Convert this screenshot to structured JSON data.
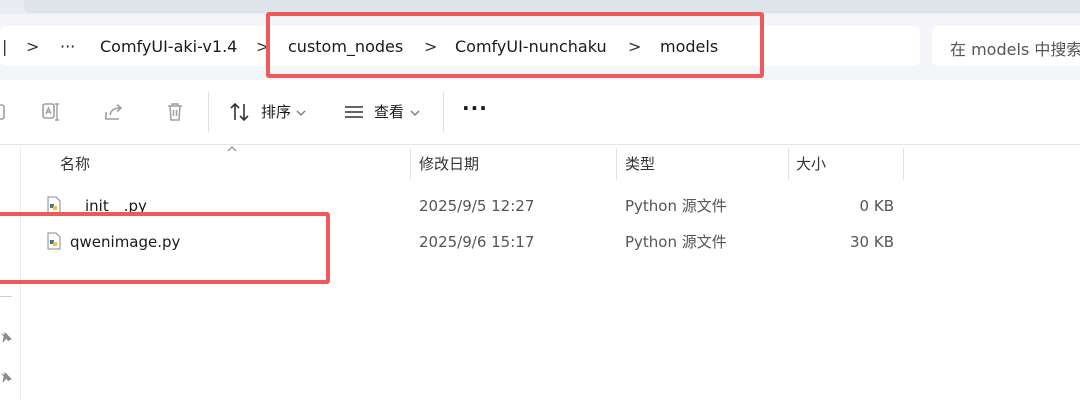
{
  "breadcrumbs": {
    "ellipsis": "···",
    "items": [
      "ComfyUI-aki-v1.4",
      "custom_nodes",
      "ComfyUI-nunchaku",
      "models"
    ],
    "separator": ">"
  },
  "search": {
    "placeholder": "在 models 中搜索"
  },
  "toolbar": {
    "sort_label": "排序",
    "view_label": "查看",
    "more_label": "···"
  },
  "columns": {
    "name": "名称",
    "modified": "修改日期",
    "type": "类型",
    "size": "大小"
  },
  "files": [
    {
      "name": "__init__.py",
      "modified": "2025/9/5 12:27",
      "type": "Python 源文件",
      "size": "0 KB"
    },
    {
      "name": "qwenimage.py",
      "modified": "2025/9/6 15:17",
      "type": "Python 源文件",
      "size": "30 KB"
    }
  ],
  "colors": {
    "highlight": "#ee5a5a",
    "address_bg": "#f3f5f8"
  }
}
